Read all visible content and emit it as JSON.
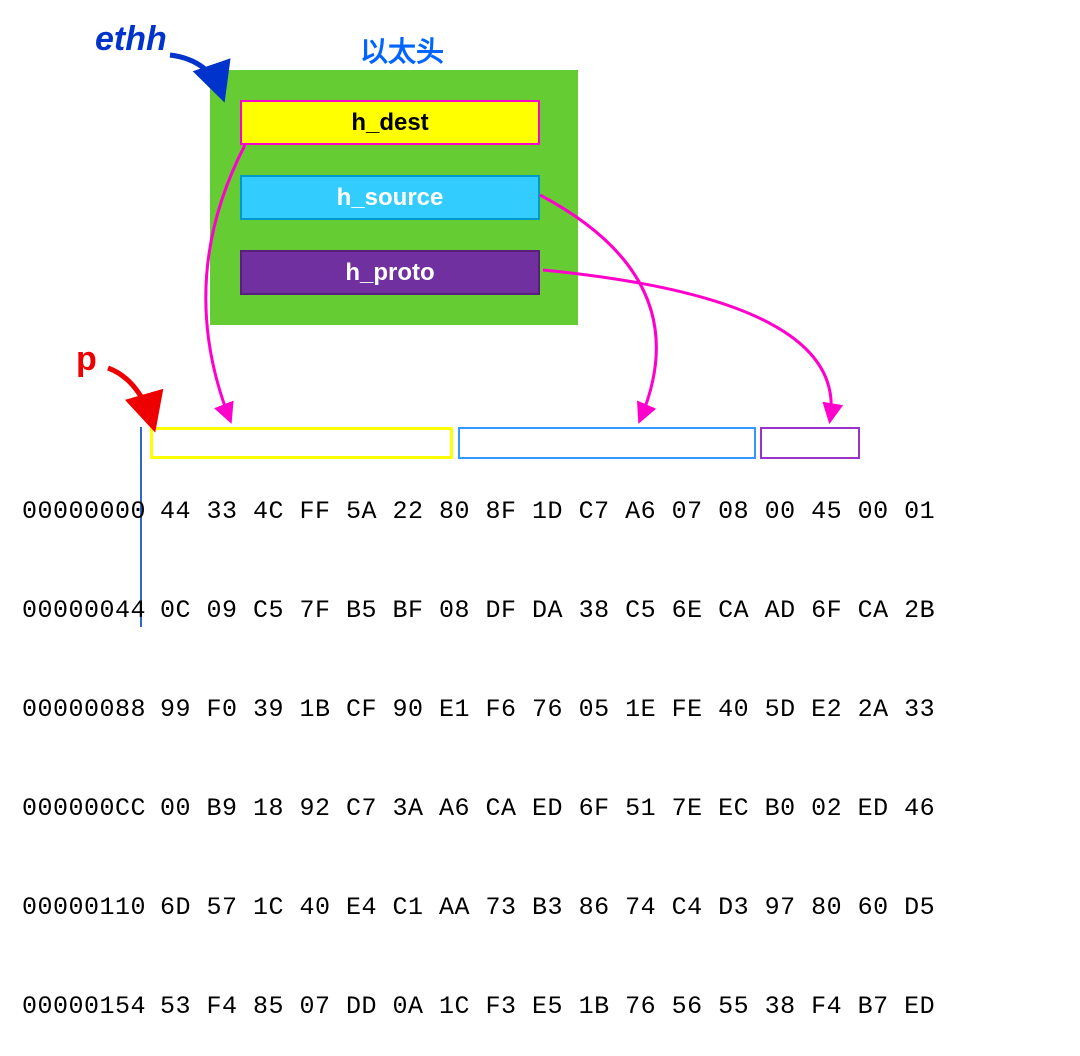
{
  "labels": {
    "ethh": "ethh",
    "p": "p",
    "title": "以太头"
  },
  "fields": {
    "h_dest": "h_dest",
    "h_source": "h_source",
    "h_proto": "h_proto"
  },
  "hex": {
    "offsets": [
      "00000000",
      "00000044",
      "00000088",
      "000000CC",
      "00000110",
      "00000154"
    ],
    "rows": [
      "44 33 4C FF 5A 22 80 8F 1D C7 A6 07 08 00 45 00 01",
      "0C 09 C5 7F B5 BF 08 DF DA 38 C5 6E CA AD 6F CA 2B",
      "99 F0 39 1B CF 90 E1 F6 76 05 1E FE 40 5D E2 2A 33",
      "00 B9 18 92 C7 3A A6 CA ED 6F 51 7E EC B0 02 ED 46",
      "6D 57 1C 40 E4 C1 AA 73 B3 86 74 C4 D3 97 80 60 D5",
      "53 F4 85 07 DD 0A 1C F3 E5 1B 76 56 55 38 F4 B7 ED"
    ]
  },
  "colors": {
    "green": "#66cc33",
    "yellow": "#ffff00",
    "cyan": "#33ccff",
    "purple": "#7030a0",
    "magenta": "#ff00cc",
    "blue": "#0033cc",
    "red": "#ee0000",
    "lightblue": "#0066ff"
  }
}
